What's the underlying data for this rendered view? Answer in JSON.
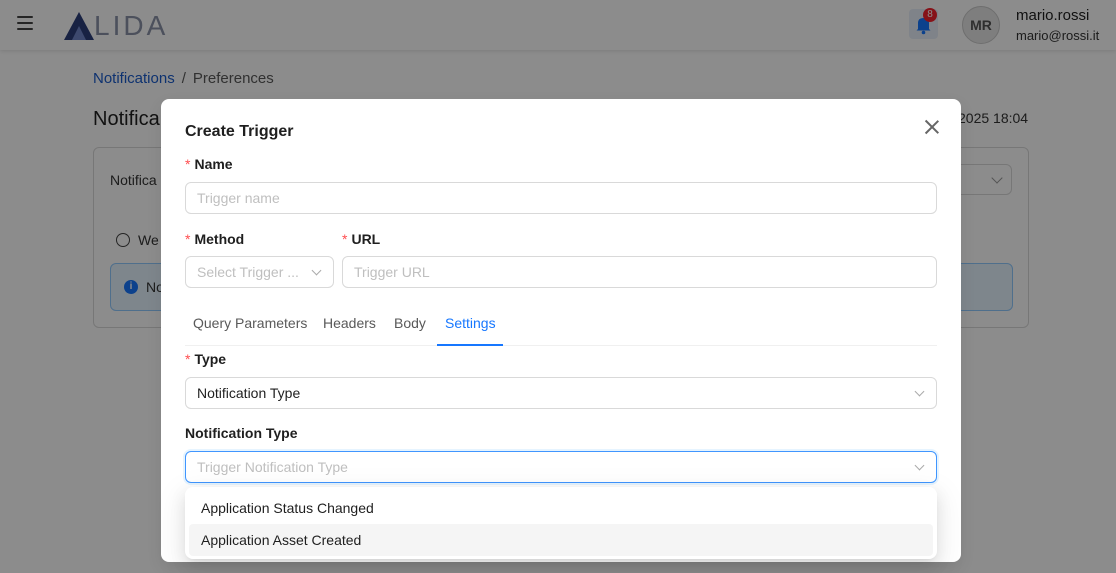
{
  "header": {
    "logo_text": "LIDA",
    "notification_count": "8",
    "avatar_initials": "MR",
    "user_name": "mario.rossi",
    "user_email": "mario@rossi.it"
  },
  "background": {
    "breadcrumb": {
      "link": "Notifications",
      "separator": "/",
      "current": "Preferences"
    },
    "page_title": "Notifica",
    "page_date": "2025 18:04",
    "card_label": "Notifica",
    "web_label": "We",
    "alert_text": "No"
  },
  "modal": {
    "title": "Create Trigger",
    "name": {
      "label": "Name",
      "placeholder": "Trigger name"
    },
    "method": {
      "label": "Method",
      "placeholder": "Select Trigger ..."
    },
    "url": {
      "label": "URL",
      "placeholder": "Trigger URL"
    },
    "tabs": [
      {
        "label": "Query Parameters"
      },
      {
        "label": "Headers"
      },
      {
        "label": "Body"
      },
      {
        "label": "Settings"
      }
    ],
    "active_tab": "Settings",
    "type": {
      "label": "Type",
      "value": "Notification Type"
    },
    "notification_type": {
      "label": "Notification Type",
      "placeholder": "Trigger Notification Type"
    },
    "dropdown_options": [
      {
        "label": "Application Status Changed"
      },
      {
        "label": "Application Asset Created"
      }
    ]
  },
  "colors": {
    "accent": "#1677ff",
    "required": "#ff4d4f",
    "badge": "#f5222d",
    "link": "#1a5ccc"
  }
}
